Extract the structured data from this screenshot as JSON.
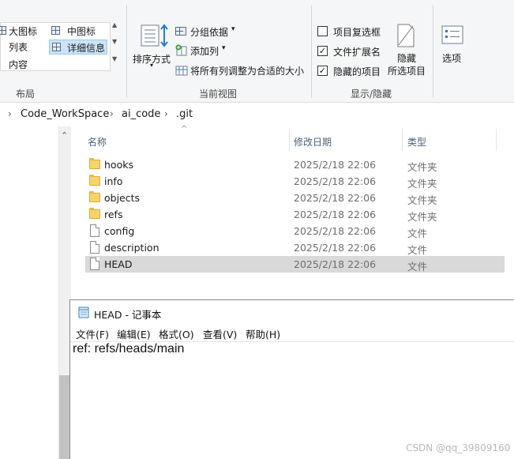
{
  "ribbon": {
    "layout": {
      "items": [
        "大图标",
        "中图标",
        "列表",
        "详细信息",
        "内容"
      ],
      "title": "布局"
    },
    "current_view": {
      "sort_label": "排序方式",
      "group_by": "分组依据",
      "add_column": "添加列",
      "fit_columns": "将所有列调整为合适的大小",
      "title": "当前视图"
    },
    "show_hide": {
      "item_checkboxes": {
        "label": "项目复选框",
        "checked": false
      },
      "file_extensions": {
        "label": "文件扩展名",
        "checked": true
      },
      "hidden_items": {
        "label": "隐藏的项目",
        "checked": true
      },
      "hide_selected_line1": "隐藏",
      "hide_selected_line2": "所选项目",
      "title": "显示/隐藏"
    },
    "options_label": "选项"
  },
  "address": {
    "crumbs": [
      "Code_WorkSpace",
      "ai_code",
      ".git"
    ]
  },
  "columns": {
    "name": "名称",
    "date": "修改日期",
    "type": "类型"
  },
  "files": [
    {
      "name": "hooks",
      "date": "2025/2/18 22:06",
      "type": "文件夹",
      "icon": "folder-icon"
    },
    {
      "name": "info",
      "date": "2025/2/18 22:06",
      "type": "文件夹",
      "icon": "folder-icon"
    },
    {
      "name": "objects",
      "date": "2025/2/18 22:06",
      "type": "文件夹",
      "icon": "folder-icon"
    },
    {
      "name": "refs",
      "date": "2025/2/18 22:06",
      "type": "文件夹",
      "icon": "folder-icon"
    },
    {
      "name": "config",
      "date": "2025/2/18 22:06",
      "type": "文件",
      "icon": "file-icon"
    },
    {
      "name": "description",
      "date": "2025/2/18 22:06",
      "type": "文件",
      "icon": "file-icon"
    },
    {
      "name": "HEAD",
      "date": "2025/2/18 22:06",
      "type": "文件",
      "icon": "file-icon"
    }
  ],
  "notepad": {
    "title": "HEAD - 记事本",
    "menus": [
      "文件(F)",
      "编辑(E)",
      "格式(O)",
      "查看(V)",
      "帮助(H)"
    ],
    "content": "ref: refs/heads/main"
  },
  "watermark": "CSDN @qq_39809160",
  "colors": {
    "selection": "#cce4f7",
    "selected_row": "#d9d9d9",
    "folder": "#f7d36b"
  }
}
